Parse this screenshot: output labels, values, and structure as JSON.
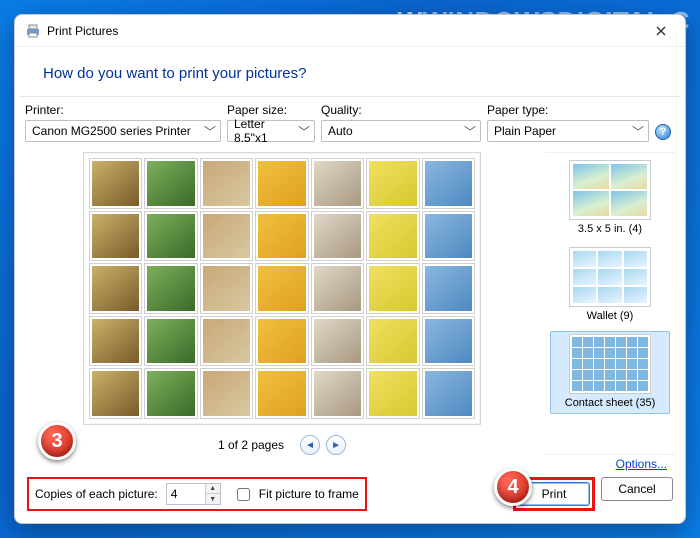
{
  "watermark": "WINDOWSDIGITAL.C",
  "dialog": {
    "title": "Print Pictures",
    "question": "How do you want to print your pictures?"
  },
  "controls": {
    "printer": {
      "label": "Printer:",
      "value": "Canon MG2500 series Printer"
    },
    "paper_size": {
      "label": "Paper size:",
      "value": "Letter 8.5\"x1"
    },
    "quality": {
      "label": "Quality:",
      "value": "Auto"
    },
    "paper_type": {
      "label": "Paper type:",
      "value": "Plain Paper"
    }
  },
  "pager": {
    "text": "1 of 2 pages"
  },
  "layouts": {
    "opt1": "3.5 x 5 in. (4)",
    "opt2": "Wallet (9)",
    "opt3": "Contact sheet (35)"
  },
  "bottom": {
    "copies_label": "Copies of each picture:",
    "copies_value": "4",
    "fit_label": "Fit picture to frame",
    "options_link": "Options...",
    "print": "Print",
    "cancel": "Cancel"
  },
  "annotations": {
    "b3": "3",
    "b4": "4"
  }
}
